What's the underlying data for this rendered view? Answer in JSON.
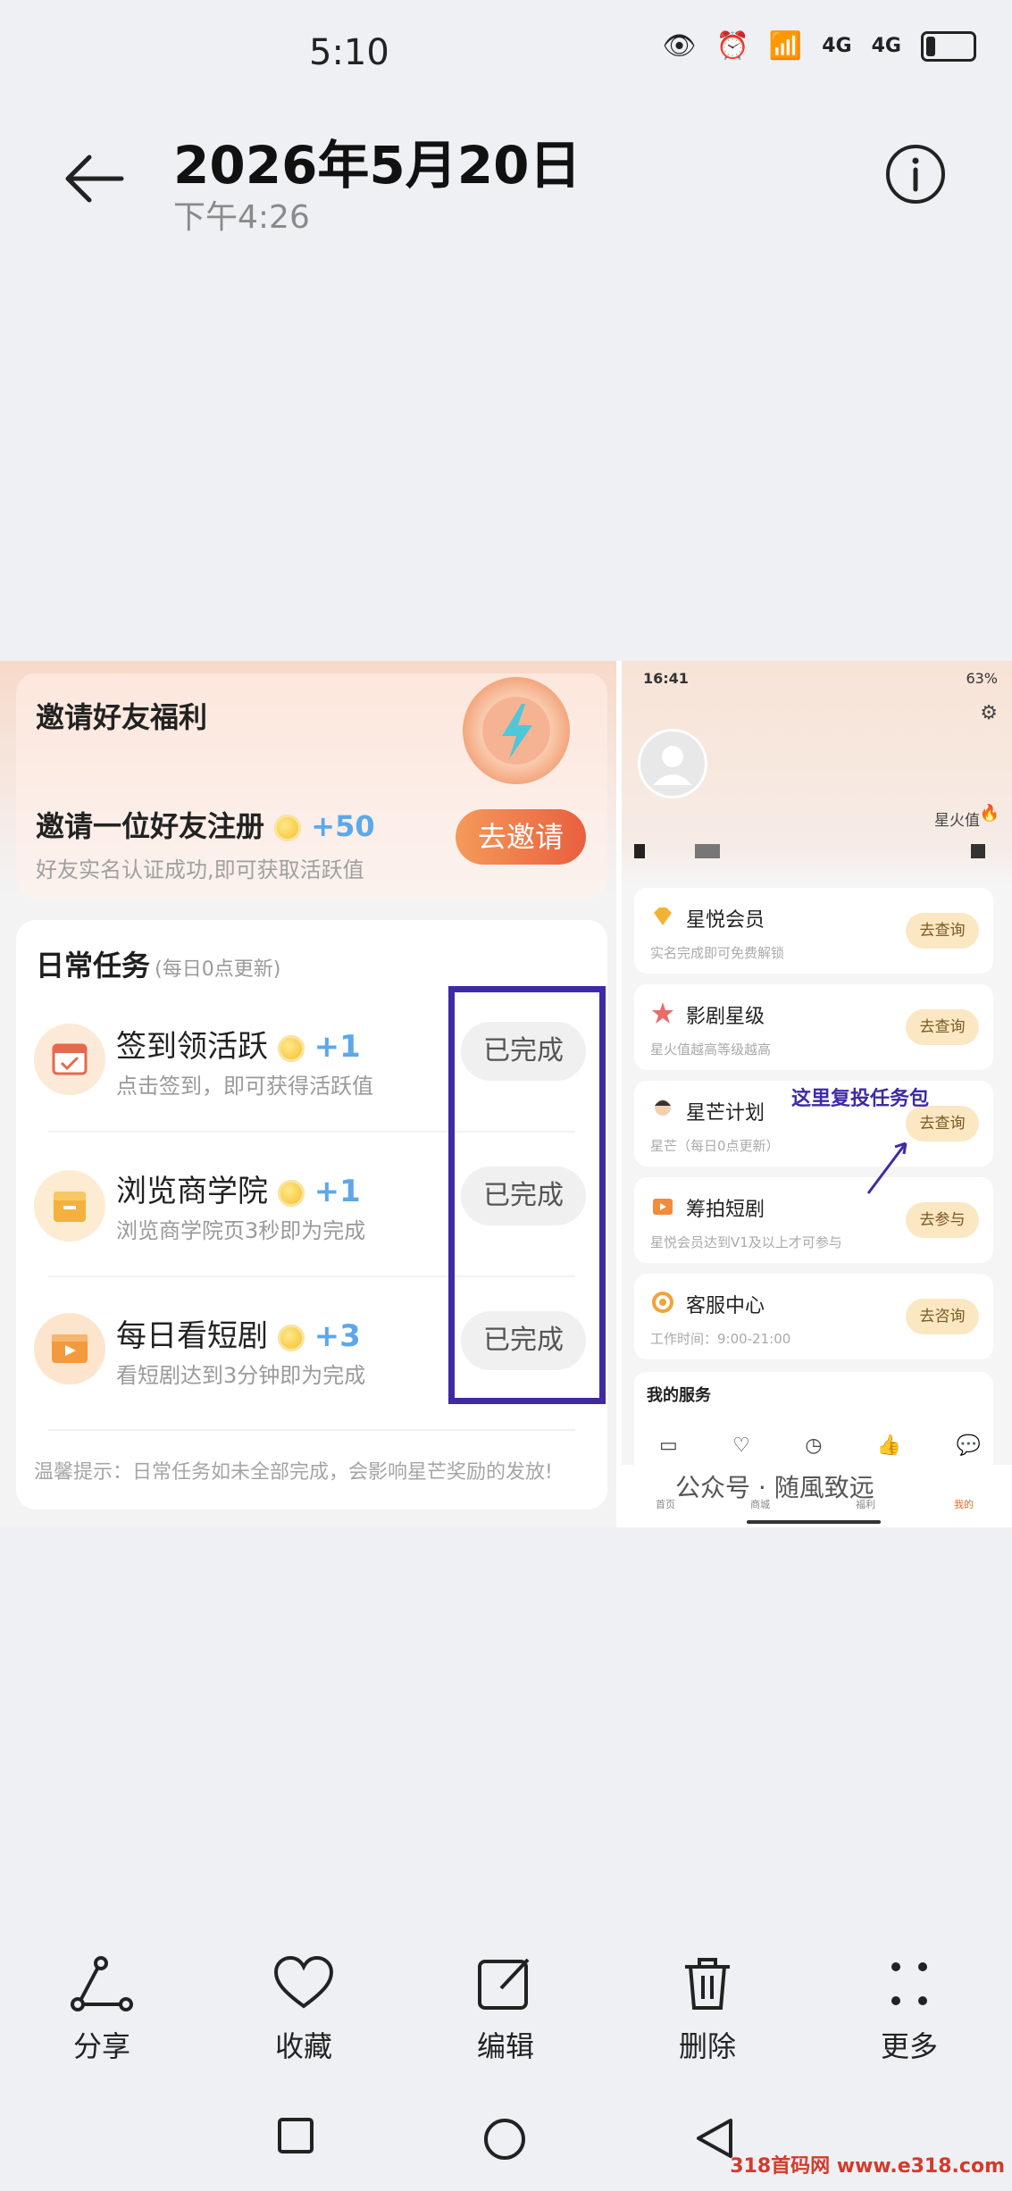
{
  "status": {
    "time": "5:10",
    "net1": "4G",
    "net2": "4G"
  },
  "header": {
    "title": "2026年5月20日",
    "subtitle": "下午4:26"
  },
  "left": {
    "invite_header": "邀请好友福利",
    "invite_main": "邀请一位好友注册",
    "invite_points": "+50",
    "invite_desc": "好友实名认证成功,即可获取活跃值",
    "invite_button": "去邀请",
    "daily_title": "日常任务",
    "daily_note": "(每日0点更新)",
    "tasks": [
      {
        "title": "签到领活跃",
        "points": "+1",
        "desc": "点击签到，即可获得活跃值",
        "status": "已完成"
      },
      {
        "title": "浏览商学院",
        "points": "+1",
        "desc": "浏览商学院页3秒即为完成",
        "status": "已完成"
      },
      {
        "title": "每日看短剧",
        "points": "+3",
        "desc": "看短剧达到3分钟即为完成",
        "status": "已完成"
      }
    ],
    "tip": "温馨提示：日常任务如未全部完成，会影响星芒奖励的发放!"
  },
  "right": {
    "time": "16:41",
    "battery": "63%",
    "xinghuo_label": "星火值",
    "annotation": "这里复投任务包",
    "items": [
      {
        "title": "星悦会员",
        "desc": "实名完成即可免费解锁",
        "button": "去查询"
      },
      {
        "title": "影剧星级",
        "desc": "星火值越高等级越高",
        "button": "去查询"
      },
      {
        "title": "星芒计划",
        "desc": "星芒（每日0点更新）",
        "button": "去查询"
      },
      {
        "title": "筹拍短剧",
        "desc": "星悦会员达到V1及以上才可参与",
        "button": "去参与"
      },
      {
        "title": "客服中心",
        "desc": "工作时间：9:00-21:00",
        "button": "去咨询"
      }
    ],
    "services_title": "我的服务",
    "tabs": [
      "首页",
      "商城",
      "福利",
      "我的"
    ],
    "watermark": "公众号 · 随風致远"
  },
  "toolbar": {
    "share": "分享",
    "favorite": "收藏",
    "edit": "编辑",
    "delete": "删除",
    "more": "更多"
  },
  "site_watermark": "318首码网 www.e318.com"
}
